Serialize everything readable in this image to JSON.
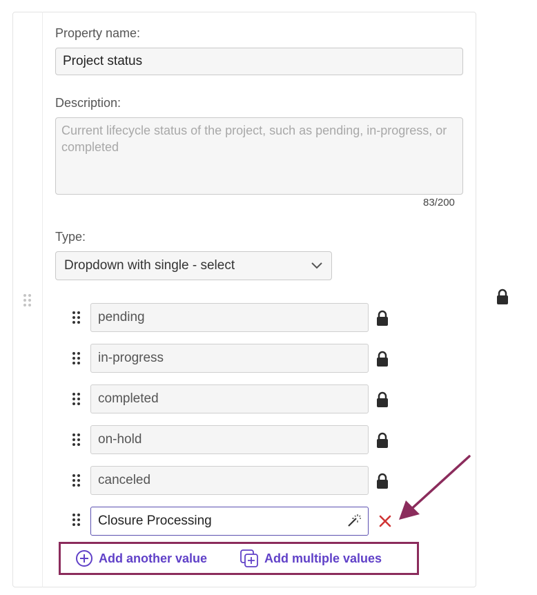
{
  "property": {
    "name_label": "Property name:",
    "name_value": "Project status",
    "description_label": "Description:",
    "description_placeholder": "Current lifecycle status of the project, such as pending, in-progress, or completed",
    "char_count": "83/200",
    "type_label": "Type:",
    "type_value": "Dropdown with single - select"
  },
  "values": [
    {
      "label": "pending"
    },
    {
      "label": "in-progress"
    },
    {
      "label": "completed"
    },
    {
      "label": "on-hold"
    },
    {
      "label": "canceled"
    }
  ],
  "new_value": "Closure Processing",
  "actions": {
    "add_another": "Add another value",
    "add_multiple": "Add multiple values"
  },
  "colors": {
    "accent": "#6041c8",
    "highlight_border": "#8b2c5c",
    "delete": "#d03535",
    "arrow": "#8b2c5c"
  }
}
